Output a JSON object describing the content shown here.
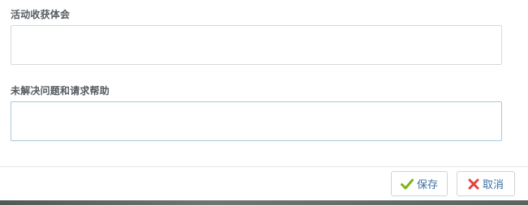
{
  "form": {
    "fields": [
      {
        "label": "活动收获体会",
        "value": ""
      },
      {
        "label": "未解决问题和请求帮助",
        "value": ""
      }
    ]
  },
  "footer": {
    "save_label": "保存",
    "cancel_label": "取消",
    "save_icon": "check-icon",
    "cancel_icon": "close-icon"
  },
  "colors": {
    "save_icon": "#7cb518",
    "cancel_icon": "#e0443a",
    "button_text": "#3d6fa6"
  }
}
